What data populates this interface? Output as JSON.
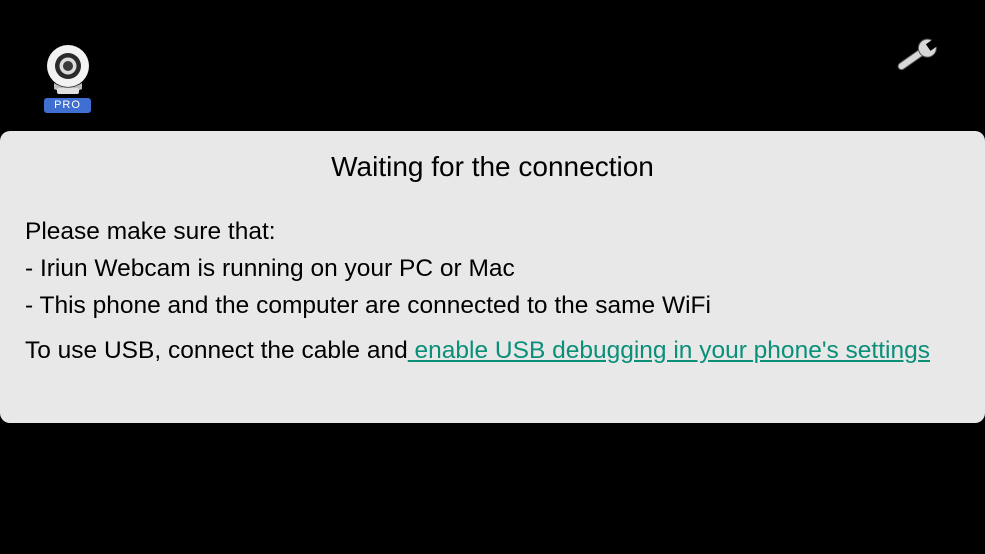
{
  "app": {
    "badge": "PRO",
    "logo_icon": "webcam-icon",
    "settings_icon": "wrench-icon"
  },
  "card": {
    "title": "Waiting for the connection",
    "intro": "Please make sure that:",
    "items": [
      "- Iriun Webcam is running on your PC or Mac",
      "- This phone and the computer are connected to the same WiFi"
    ],
    "usb_text": "To use USB, connect the cable and",
    "usb_link": " enable USB debugging in your phone's settings"
  },
  "colors": {
    "background": "#000000",
    "card": "#e8e8e8",
    "link": "#0a8f79",
    "badge": "#3f6fd0"
  }
}
